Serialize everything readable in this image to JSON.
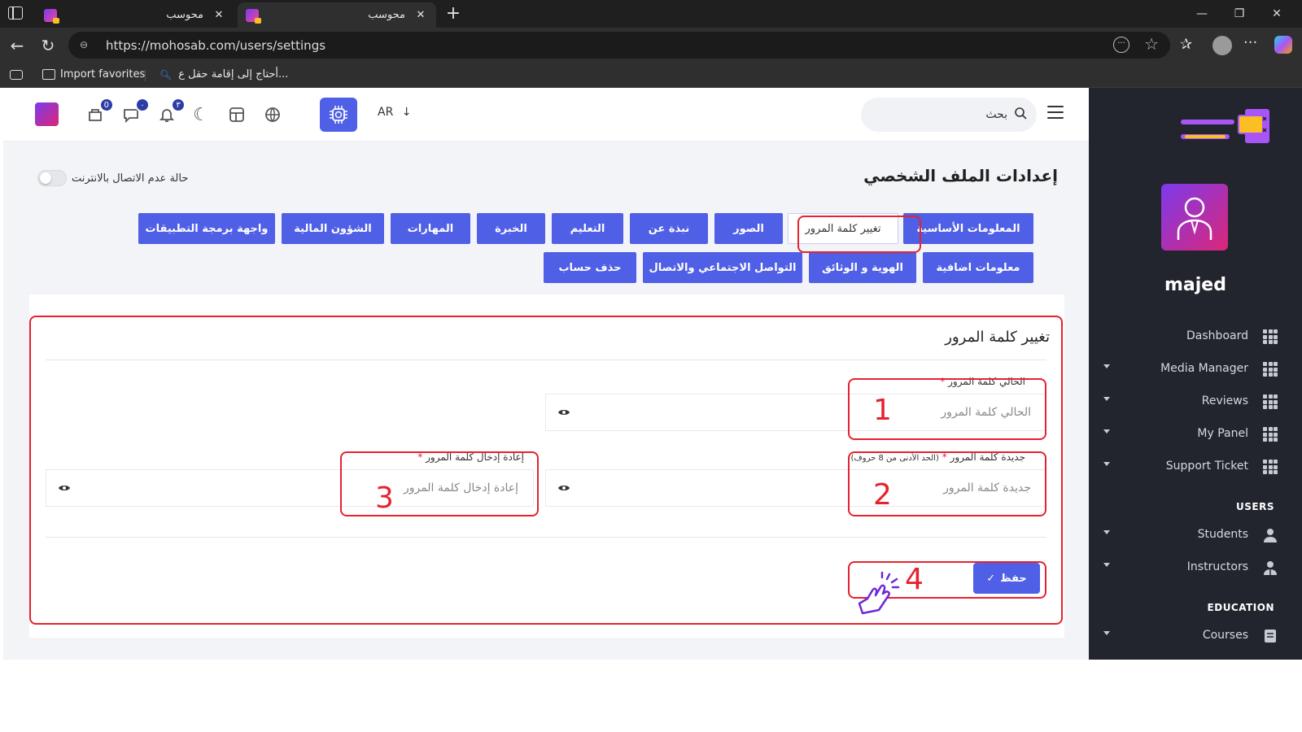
{
  "browser": {
    "tabs": [
      {
        "title": "محوسب",
        "active": false
      },
      {
        "title": "محوسب",
        "active": true
      }
    ],
    "url": "https://mohosab.com/users/settings",
    "favorites": [
      {
        "label": "Import favorites"
      },
      {
        "label": "أحتاج إلى إقامة حقل ع..."
      }
    ]
  },
  "topnav": {
    "language": "AR",
    "search_placeholder": "بحث",
    "badges": {
      "tasks": "0",
      "messages": "٠",
      "notifications": "٣"
    }
  },
  "page": {
    "heading": "إعدادات الملف الشخصي",
    "offline_label": "حالة عدم الاتصال بالانترنت",
    "tabs_row1": [
      "المعلومات الأساسية",
      "تغيير كلمة المرور",
      "الصور",
      "نبذة عن",
      "التعليم",
      "الخبرة",
      "المهارات",
      "الشؤون المالية",
      "واجهة برمجة التطبيقات"
    ],
    "tabs_row2": [
      "معلومات اضافية",
      "الهوية و الوثائق",
      "التواصل الاجتماعي والاتصال",
      "حذف حساب"
    ],
    "active_tab": "تغيير كلمة المرور"
  },
  "form": {
    "title": "تغيير كلمة المرور",
    "current_label": "الحالي كلمة المرور",
    "current_placeholder": "الحالي كلمة المرور",
    "new_label": "جديدة كلمة المرور",
    "new_hint": "(الحد الأدنى من 8 حروف)",
    "new_placeholder": "جديدة  كلمة المرور",
    "confirm_label": "إعادة إدخال كلمة المرور",
    "confirm_placeholder": "إعادة إدخال كلمة المرور",
    "required_mark": "*",
    "save_label": "حفظ",
    "save_check": "✓"
  },
  "annotations": {
    "step1": "1",
    "step2": "2",
    "step3": "3",
    "step4": "4"
  },
  "sidebar": {
    "username": "majed",
    "items": [
      {
        "label": "Dashboard",
        "caret": false
      },
      {
        "label": "Media Manager",
        "caret": true
      },
      {
        "label": "Reviews",
        "caret": true
      },
      {
        "label": "My Panel",
        "caret": true
      },
      {
        "label": "Support Ticket",
        "caret": true
      }
    ],
    "users_header": "USERS",
    "users_items": [
      {
        "label": "Students",
        "caret": true
      },
      {
        "label": "Instructors",
        "caret": true
      }
    ],
    "education_header": "EDUCATION",
    "education_items": [
      {
        "label": "Courses",
        "caret": true
      }
    ]
  },
  "colors": {
    "primary": "#4f5fe6",
    "highlight": "#e5222e",
    "sidebar": "#23252e"
  }
}
